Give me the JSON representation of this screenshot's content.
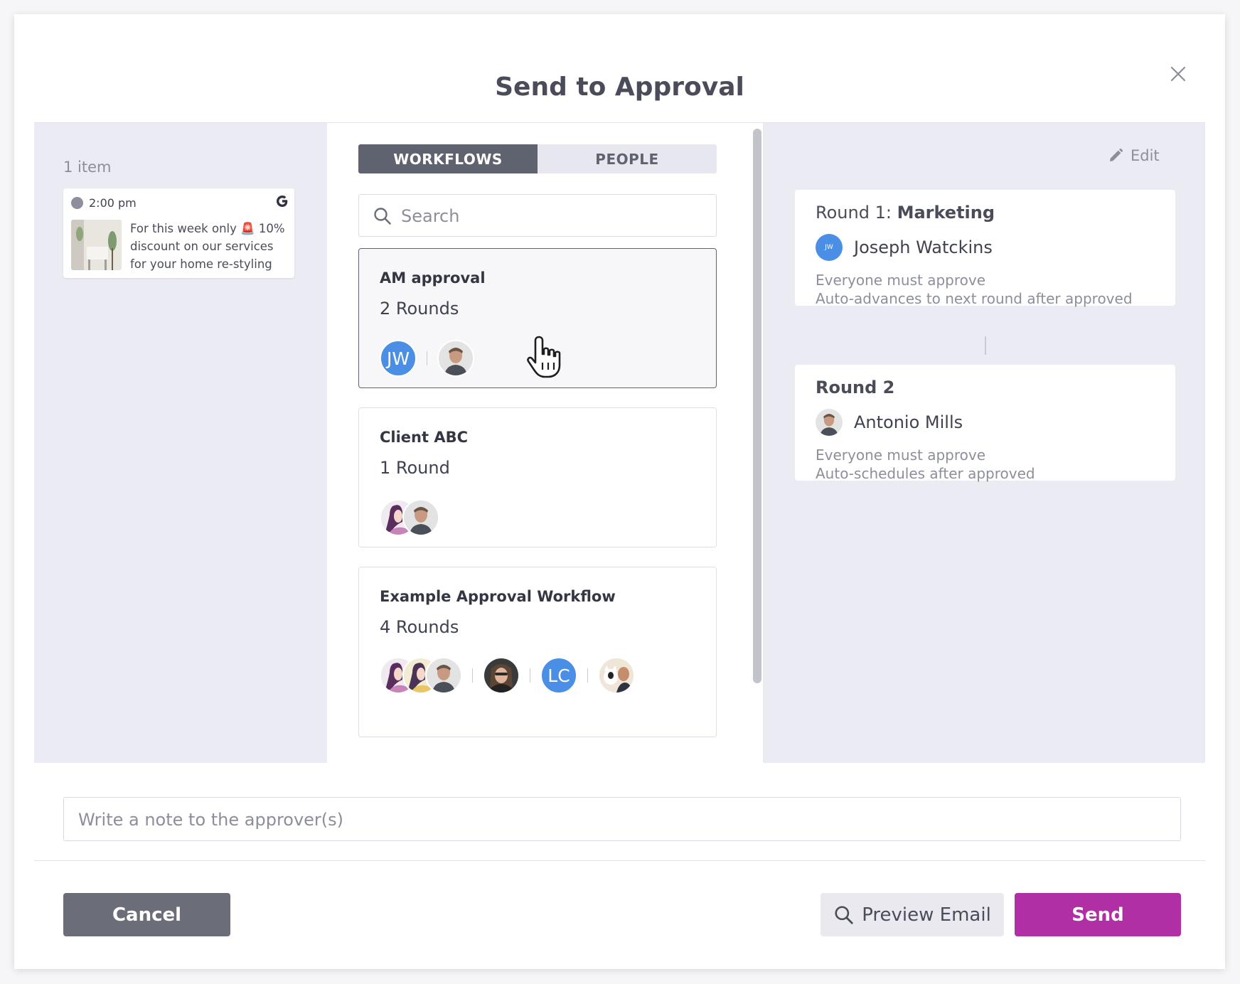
{
  "dialog": {
    "title": "Send to Approval",
    "close_icon": "close-icon"
  },
  "items_panel": {
    "count_label": "1 item",
    "post": {
      "time": "2:00 pm",
      "network_icon": "google-icon",
      "text": "For this week only 🚨 10% discount on our services for your home re-styling"
    }
  },
  "tabs": [
    {
      "label": "WORKFLOWS",
      "active": true
    },
    {
      "label": "PEOPLE",
      "active": false
    }
  ],
  "search": {
    "placeholder": "Search",
    "value": ""
  },
  "workflows": [
    {
      "name": "AM approval",
      "rounds": "2 Rounds",
      "selected": true,
      "avatar_groups": [
        [
          "JW"
        ],
        [
          "photo-man"
        ]
      ]
    },
    {
      "name": "Client ABC",
      "rounds": "1 Round",
      "selected": false,
      "avatar_groups": [
        [
          "illustration-woman",
          "photo-man"
        ]
      ]
    },
    {
      "name": "Example Approval Workflow",
      "rounds": "4 Rounds",
      "selected": false,
      "avatar_groups": [
        [
          "illustration-woman",
          "illustration-woman-2",
          "photo-man"
        ],
        [
          "photo-woman"
        ],
        [
          "LC"
        ],
        [
          "photo-cat-man"
        ]
      ]
    }
  ],
  "workflow_detail": {
    "edit_label": "Edit",
    "rounds": [
      {
        "title_prefix": "Round 1: ",
        "title_name": "Marketing",
        "approver_initials": "JW",
        "approver_name": "Joseph Watckins",
        "rule1": "Everyone must approve",
        "rule2": "Auto-advances to next round after approved"
      },
      {
        "title_prefix": "",
        "title_name": "Round 2",
        "approver_name": "Antonio Mills",
        "rule1": "Everyone must approve",
        "rule2": "Auto-schedules after approved"
      }
    ]
  },
  "note": {
    "placeholder": "Write a note to the approver(s)",
    "value": ""
  },
  "footer": {
    "cancel_label": "Cancel",
    "preview_label": "Preview Email",
    "send_label": "Send"
  },
  "colors": {
    "send": "#b02fa4",
    "cancel": "#6b6e79",
    "tab_active": "#5f6370",
    "initials_avatar": "#4a8ee6",
    "panel_bg": "#eaebf3"
  }
}
